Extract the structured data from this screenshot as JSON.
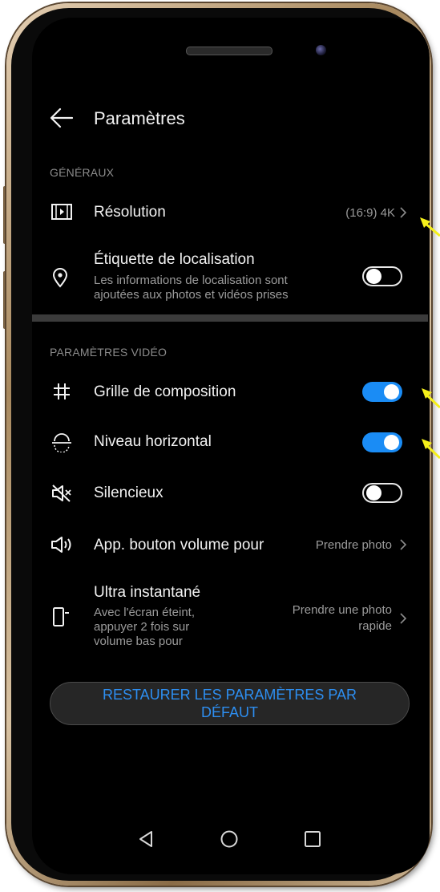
{
  "header": {
    "title": "Paramètres"
  },
  "sections": {
    "general": "GÉNÉRAUX",
    "video": "PARAMÈTRES VIDÉO"
  },
  "settings": {
    "resolution": {
      "label": "Résolution",
      "value": "(16:9) 4K"
    },
    "location": {
      "label": "Étiquette de localisation",
      "desc_line1": "Les informations de localisation sont",
      "desc_line2": "ajoutées aux photos et vidéos prises",
      "enabled": false
    },
    "grid": {
      "label": "Grille de composition",
      "enabled": true
    },
    "level": {
      "label": "Niveau horizontal",
      "enabled": true
    },
    "silent": {
      "label": "Silencieux",
      "enabled": false
    },
    "volume_button": {
      "label": "App. bouton volume pour",
      "value": "Prendre photo"
    },
    "ultra_snapshot": {
      "label": "Ultra instantané",
      "desc_line1": "Avec l'écran éteint,",
      "desc_line2": "appuyer 2 fois sur",
      "desc_line3": "volume bas pour",
      "value_line1": "Prendre une photo",
      "value_line2": "rapide"
    }
  },
  "restore_button": {
    "line1": "RESTAURER LES PARAMÈTRES PAR",
    "line2": "DÉFAUT"
  },
  "colors": {
    "accent": "#1a8cf5",
    "restore_text": "#2d8ef0",
    "annotation_arrow": "#f5f01a"
  }
}
